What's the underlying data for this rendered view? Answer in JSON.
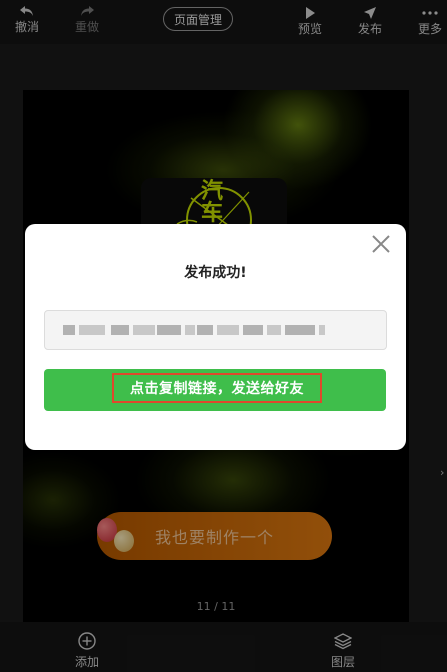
{
  "toolbar": {
    "undo_label": "撤消",
    "redo_label": "重做",
    "page_manage_label": "页面管理",
    "preview_label": "预览",
    "publish_label": "发布",
    "more_label": "更多"
  },
  "canvas": {
    "logo_text_line1": "汽",
    "logo_text_line2": "车",
    "cta_label": "我也要制作一个",
    "page_counter": "11 / 11"
  },
  "modal": {
    "title": "发布成功!",
    "copy_button_label": "点击复制链接，发送给好友"
  },
  "bottombar": {
    "add_label": "添加",
    "layers_label": "图层"
  },
  "colors": {
    "accent_green": "#3fbe4b",
    "highlight_border": "#e0482c",
    "cta_orange": "#e07a10"
  }
}
